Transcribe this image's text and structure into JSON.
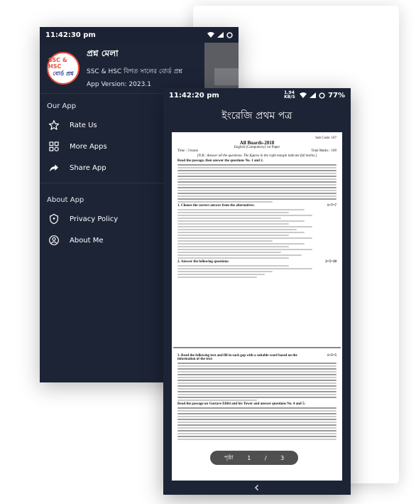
{
  "drawer_screen": {
    "status": {
      "time": "11:42:30 pm",
      "battery_icon": "battery-ring-icon"
    },
    "header": {
      "logo_line1": "SSC & HSC",
      "logo_line2": "বোর্ড প্রশ্ন",
      "app_name": "প্রশ্ন মেলা",
      "subtitle": "SSC & HSC বিগত সালের বোর্ড প্রশ্ন",
      "version": "App Version: 2023.1"
    },
    "sections": [
      {
        "title": "Our App",
        "items": [
          {
            "label": "Rate Us",
            "icon": "star-icon"
          },
          {
            "label": "More Apps",
            "icon": "grid-icon"
          },
          {
            "label": "Share App",
            "icon": "share-arrow-icon"
          }
        ]
      },
      {
        "title": "About App",
        "items": [
          {
            "label": "Privacy Policy",
            "icon": "shield-icon"
          },
          {
            "label": "About Me",
            "icon": "person-icon"
          }
        ]
      }
    ]
  },
  "reader_screen": {
    "status": {
      "time": "11:42:20 pm",
      "net": "1.94 KB/S",
      "battery": "77%"
    },
    "title": "ইংরেজি প্রথম পত্র",
    "document": {
      "heading": "All Boards-2018",
      "subheading": "English (Compulsory) 1st Paper",
      "sub_code_label": "Sub Code",
      "sub_code": "107",
      "time": "Time : 3 hours",
      "marks": "Total Marks : 100",
      "note": "[N.B.: Answer all the questions. The figures in the right margin indicate full marks.]",
      "part_a_lead": "Read the passage, then answer the questions No. 1 and 2.",
      "q1": "1.  Choose the correct answer from the alternatives:",
      "q1_marks": "1×7=7",
      "q2": "2.  Answer the following questions:",
      "q2_marks": "2×5=10",
      "q3": "3.  Read the following text and fill in each gap with a suitable word based on the information of the text:",
      "q3_marks": "1×5=5",
      "q4_lead": "Read the passage on Gustave Eiffel and his Tower and answer questions No. 4 and 5:"
    },
    "pager": {
      "label": "পৃষ্ঠা",
      "current": "1",
      "separator": "/",
      "total": "3"
    }
  }
}
